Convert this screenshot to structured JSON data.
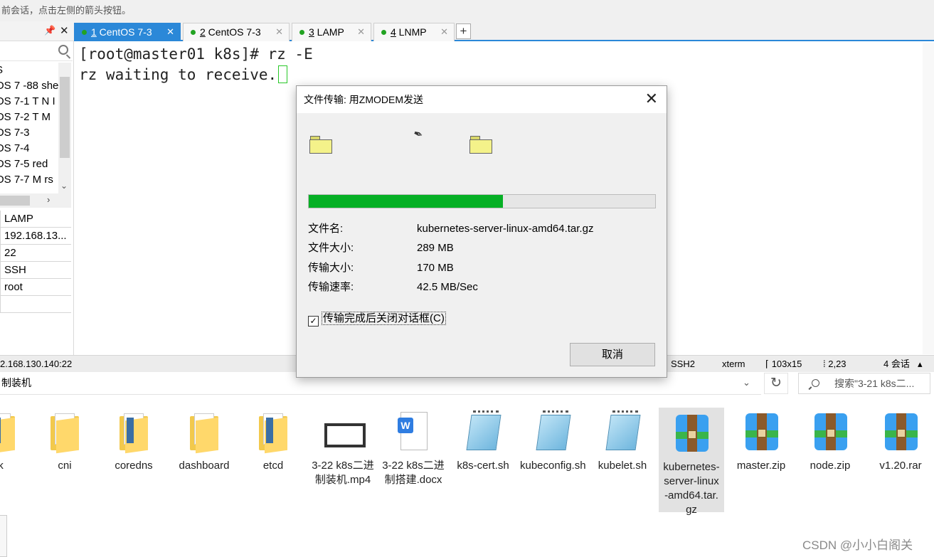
{
  "topbar": {
    "hint": "前会话，点击左侧的箭头按钮。"
  },
  "left_panel": {
    "sessions": [
      "S",
      "OS 7 -88 she",
      "OS 7-1 T N I",
      "OS 7-2 T M",
      "OS 7-3",
      "OS 7-4",
      "OS 7-5   red",
      "OS 7-7 M rs"
    ],
    "properties": [
      "LAMP",
      "192.168.13...",
      "22",
      "SSH",
      "root",
      ""
    ]
  },
  "tabs": [
    {
      "num": "1",
      "label": " CentOS 7-3",
      "active": true
    },
    {
      "num": "2",
      "label": " CentOS 7-3",
      "active": false
    },
    {
      "num": "3",
      "label": " LAMP",
      "active": false
    },
    {
      "num": "4",
      "label": " LNMP",
      "active": false
    }
  ],
  "terminal": {
    "line1": "[root@master01 k8s]# rz -E",
    "line2": "rz waiting to receive."
  },
  "statusbar": {
    "host": "2.168.130.140:22",
    "protocol": "SSH2",
    "term": "xterm",
    "size": "103x15",
    "cursor": "2,23",
    "sessions": "4 会话"
  },
  "explorer": {
    "address": "制装机",
    "search_placeholder": "搜索\"3-21 k8s二...",
    "files": [
      {
        "name": "k",
        "type": "folder"
      },
      {
        "name": "cni",
        "type": "folder"
      },
      {
        "name": "coredns",
        "type": "folder"
      },
      {
        "name": "dashboard",
        "type": "folder"
      },
      {
        "name": "etcd",
        "type": "folder"
      },
      {
        "name": "3-22 k8s二进制装机.mp4",
        "type": "video"
      },
      {
        "name": "3-22 k8s二进制搭建.docx",
        "type": "doc"
      },
      {
        "name": "k8s-cert.sh",
        "type": "script"
      },
      {
        "name": "kubeconfig.sh",
        "type": "script"
      },
      {
        "name": "kubelet.sh",
        "type": "script"
      },
      {
        "name": "kubernetes-server-linux-amd64.tar.gz",
        "type": "archive",
        "selected": true
      },
      {
        "name": "master.zip",
        "type": "archive"
      },
      {
        "name": "node.zip",
        "type": "archive"
      },
      {
        "name": "v1.20.rar",
        "type": "archive"
      }
    ]
  },
  "watermark": "CSDN @小小白阁关",
  "dialog": {
    "title": "文件传输: 用ZMODEM发送",
    "progress_fraction": 0.56,
    "rows": [
      {
        "label": "文件名:",
        "value": "kubernetes-server-linux-amd64.tar.gz"
      },
      {
        "label": "文件大小:",
        "value": "289 MB"
      },
      {
        "label": "传输大小:",
        "value": "170 MB"
      },
      {
        "label": "传输速率:",
        "value": "42.5 MB/Sec"
      }
    ],
    "checkbox_label": "传输完成后关闭对话框",
    "checkbox_accel": "(C)",
    "checkbox_checked": true,
    "cancel_label": "取消"
  },
  "colors": {
    "accent": "#2b88d8",
    "progress": "#06b025",
    "cursor": "#28c828"
  }
}
